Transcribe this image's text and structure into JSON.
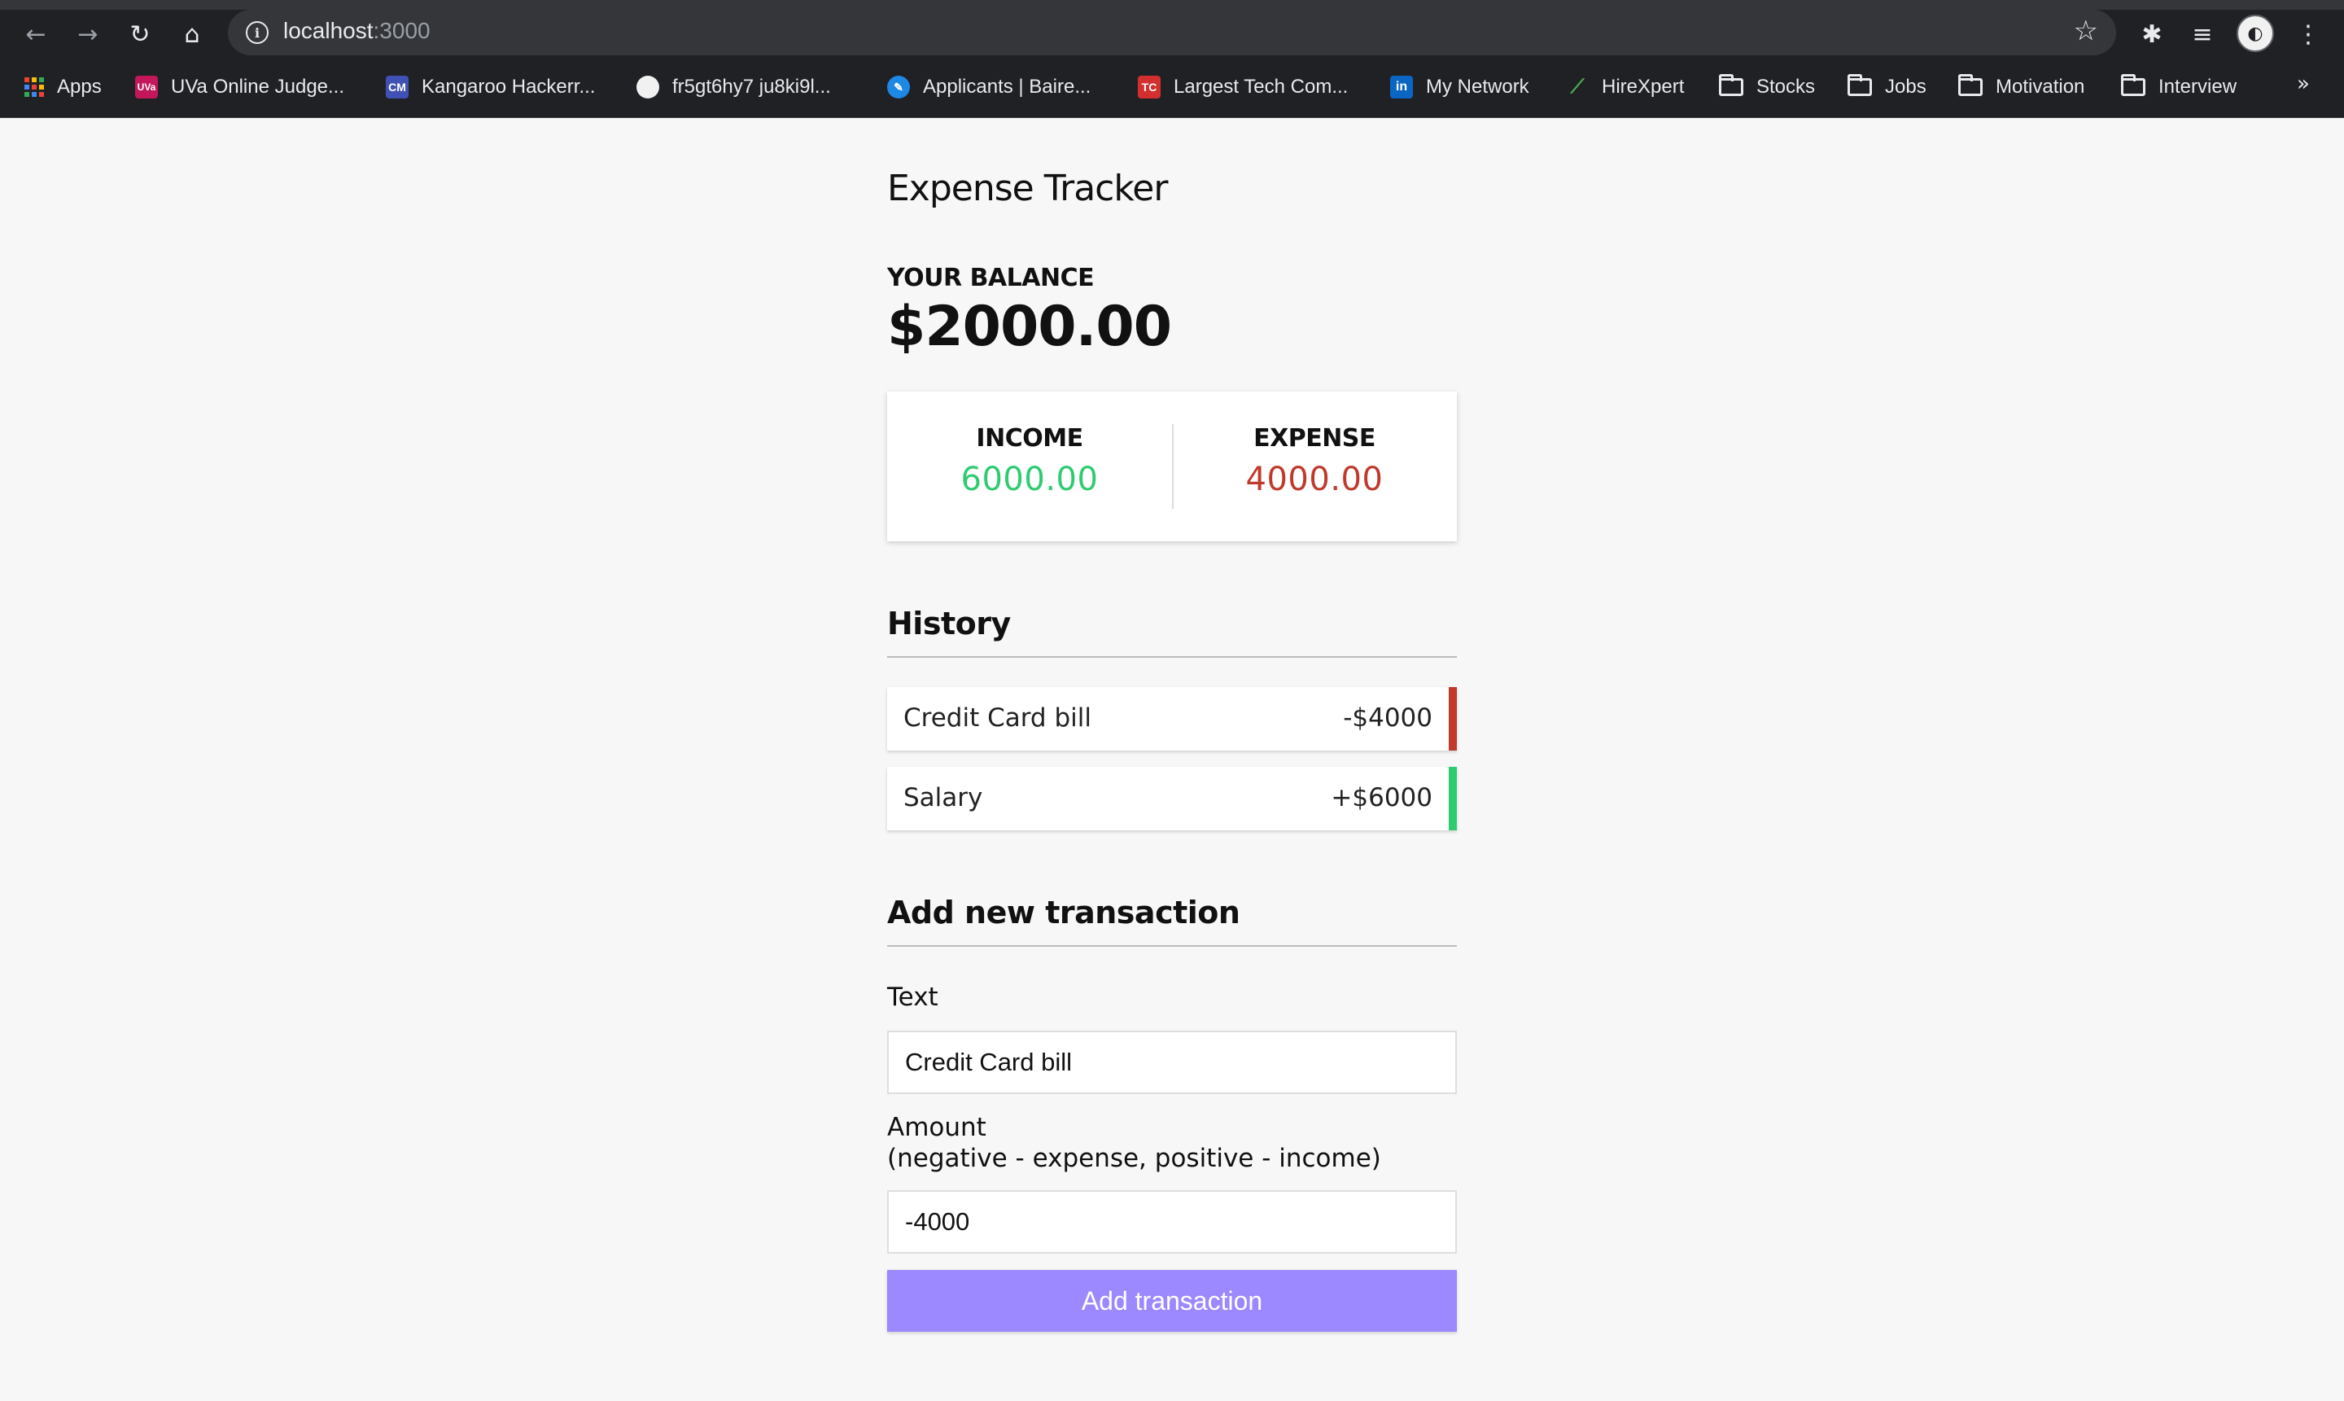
{
  "browser": {
    "url_host": "localhost",
    "url_port": ":3000",
    "bookmarks": [
      {
        "label": "Apps",
        "icon": "apps-grid-icon"
      },
      {
        "label": "UVa Online Judge...",
        "icon": "uva-icon",
        "badge": "UVa"
      },
      {
        "label": "Kangaroo Hackerr...",
        "icon": "cm-icon",
        "badge": "CM"
      },
      {
        "label": "fr5gt6hy7 ju8ki9l...",
        "icon": "circle-icon"
      },
      {
        "label": "Applicants | Baire...",
        "icon": "baire-icon"
      },
      {
        "label": "Largest Tech Com...",
        "icon": "tc-icon"
      },
      {
        "label": "My Network",
        "icon": "linkedin-icon",
        "badge": "in"
      },
      {
        "label": "HireXpert",
        "icon": "hirexpert-icon"
      },
      {
        "label": "Stocks",
        "icon": "folder-icon"
      },
      {
        "label": "Jobs",
        "icon": "folder-icon"
      },
      {
        "label": "Motivation",
        "icon": "folder-icon"
      },
      {
        "label": "Interview",
        "icon": "folder-icon"
      }
    ],
    "more_label": "»"
  },
  "app": {
    "title": "Expense Tracker",
    "balance_label": "YOUR BALANCE",
    "balance_value": "$2000.00",
    "income_label": "INCOME",
    "income_value": "6000.00",
    "expense_label": "EXPENSE",
    "expense_value": "4000.00",
    "history_heading": "History",
    "transactions": [
      {
        "text": "Credit Card bill",
        "amount": "-$4000",
        "type": "minus"
      },
      {
        "text": "Salary",
        "amount": "+$6000",
        "type": "plus"
      }
    ],
    "form_heading": "Add new transaction",
    "text_label": "Text",
    "text_value": "Credit Card bill",
    "amount_label": "Amount",
    "amount_hint": "(negative - expense, positive - income)",
    "amount_value": "-4000",
    "submit_label": "Add transaction"
  },
  "colors": {
    "income": "#2ecc71",
    "expense": "#c0392b",
    "button": "#9c88ff"
  }
}
